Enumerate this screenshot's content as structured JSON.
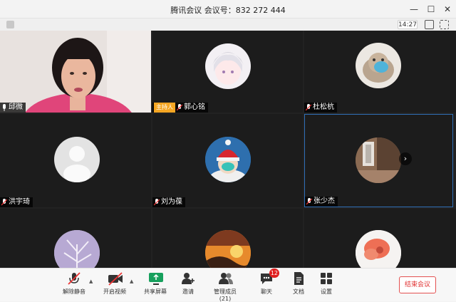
{
  "window": {
    "title": "腾讯会议 会议号：832 272 444"
  },
  "topbar": {
    "time": "14:27"
  },
  "participants": [
    {
      "name": "邱微",
      "muted": false,
      "icon": "person-camera-video"
    },
    {
      "name": "郭心铭",
      "muted": true,
      "role": "主持人",
      "icon": "anime-avatar"
    },
    {
      "name": "杜松杭",
      "muted": true,
      "icon": "cat-avatar"
    },
    {
      "name": "洪宇琦",
      "muted": true,
      "icon": "default-avatar"
    },
    {
      "name": "刘为葆",
      "muted": true,
      "icon": "snow-avatar"
    },
    {
      "name": "张少杰",
      "muted": true,
      "icon": "room-avatar"
    },
    {
      "icon": "winter-tree-avatar"
    },
    {
      "icon": "sunset-avatar"
    },
    {
      "icon": "flower-avatar"
    }
  ],
  "toolbar": {
    "unmute": "解除静音",
    "start_video": "开启视频",
    "share_screen": "共享屏幕",
    "invite": "邀请",
    "manage_members": "管理成员(21)",
    "chat": "聊天",
    "chat_badge": "12",
    "docs": "文档",
    "settings": "设置",
    "end_meeting": "结束会议"
  },
  "colors": {
    "accent": "#2f6fb8",
    "host_badge": "#f5a623",
    "end_red": "#e03030",
    "badge_red": "#e02020"
  }
}
